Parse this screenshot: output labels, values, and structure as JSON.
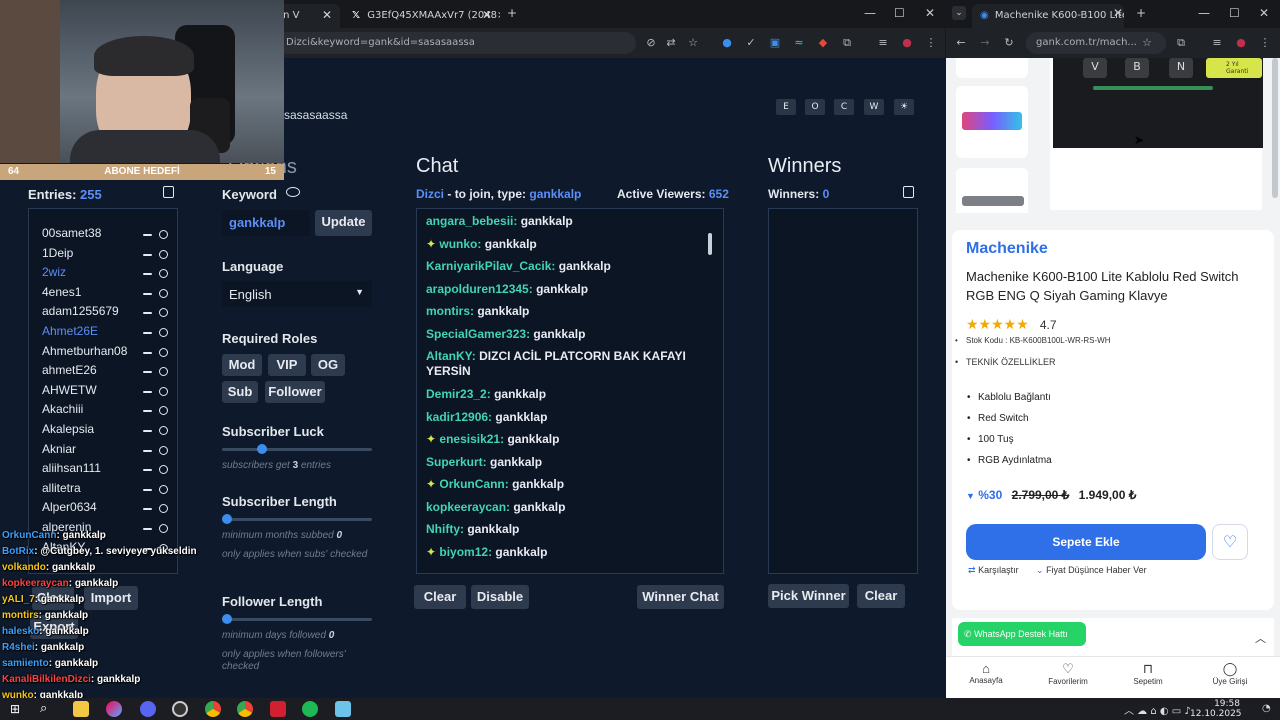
{
  "left_browser": {
    "tabs": [
      {
        "title": "ği (Uzun V"
      },
      {
        "title": "G3EfQ45XMAAxVr7 (2048×18"
      }
    ],
    "address": "Dizci&keyword=gank&id=sasasaassa",
    "window_controls": [
      "—",
      "☐",
      "✕"
    ]
  },
  "giveaway": {
    "channel_title": "sasasaassa",
    "corner_buttons": [
      "E",
      "O",
      "C",
      "W",
      "☀"
    ],
    "entries_heading": "Entries:",
    "entries_count": "255",
    "entries": [
      "00samet38",
      "1Deip",
      "2wiz",
      "4enes1",
      "adam1255679",
      "Ahmet26E",
      "Ahmetburhan08",
      "ahmetE26",
      "AHWETW",
      "Akachiii",
      "Akalepsia",
      "Akniar",
      "aliihsan111",
      "allitetra",
      "Alper0634",
      "alperenin",
      "AltanKY"
    ],
    "highlighted_entries": [
      2,
      5
    ],
    "clear_label": "Clear",
    "import_label": "Import",
    "export_label": "Export",
    "options_heading": "Options",
    "keyword_label": "Keyword",
    "keyword_value": "gankkalp",
    "update_label": "Update",
    "language_label": "Language",
    "language_value": "English",
    "roles_label": "Required Roles",
    "roles": [
      "Mod",
      "VIP",
      "OG",
      "Sub",
      "Follower"
    ],
    "sub_luck_label": "Subscriber Luck",
    "sub_luck_hint_pre": "subscribers get",
    "sub_luck_value": "3",
    "sub_luck_hint_post": "entries",
    "sub_luck_level": 0.25,
    "sub_length_label": "Subscriber Length",
    "sub_length_hint": "minimum months subbed",
    "sub_length_value": "0",
    "sub_length_note": "only applies when subs' checked",
    "follower_length_label": "Follower Length",
    "follower_length_hint": "minimum days followed",
    "follower_length_value": "0",
    "follower_length_note": "only applies when followers' checked",
    "chat_heading": "Chat",
    "chat_sub_channel": "Dizci",
    "chat_sub_mid": "- to join, type:",
    "chat_sub_keyword": "gankkalp",
    "active_viewers_label": "Active Viewers:",
    "active_viewers": "652",
    "chat_lines": [
      {
        "user": "angara_bebesii:",
        "msg": "gankkalp",
        "badge": false
      },
      {
        "user": "wunko:",
        "msg": "gankkalp",
        "badge": true
      },
      {
        "user": "KarniyarikPilav_Cacik:",
        "msg": "gankkalp",
        "badge": false
      },
      {
        "user": "arapolduren12345:",
        "msg": "gankkalp",
        "badge": false
      },
      {
        "user": "montirs:",
        "msg": "gankkalp",
        "badge": false
      },
      {
        "user": "SpecialGamer323:",
        "msg": "gankkalp",
        "badge": false
      },
      {
        "user": "AltanKY:",
        "msg": "DIZCI ACİL PLATCORN BAK KAFAYI YERSİN",
        "badge": false
      },
      {
        "user": "Demir23_2:",
        "msg": "gankkalp",
        "badge": false
      },
      {
        "user": "kadir12906:",
        "msg": "gankklap",
        "badge": false
      },
      {
        "user": "enesisik21:",
        "msg": "gankkalp",
        "badge": true
      },
      {
        "user": "Superkurt:",
        "msg": "gankkalp",
        "badge": false
      },
      {
        "user": "OrkunCann:",
        "msg": "gankkalp",
        "badge": true
      },
      {
        "user": "kopkeeraycan:",
        "msg": "gankkalp",
        "badge": false
      },
      {
        "user": "Nhifty:",
        "msg": "gankkalp",
        "badge": false
      },
      {
        "user": "biyom12:",
        "msg": "gankkalp",
        "badge": true
      }
    ],
    "chat_clear": "Clear",
    "chat_disable": "Disable",
    "winner_chat": "Winner Chat",
    "winners_heading": "Winners",
    "winners_label": "Winners:",
    "winners_count": "0",
    "pick_winner": "Pick Winner",
    "winners_clear": "Clear"
  },
  "stream_overlay": {
    "abone_left": "64",
    "abone_label": "ABONE HEDEFİ",
    "abone_right": "15",
    "chat": [
      {
        "user": "OrkunCann",
        "msg": ": gankkalp",
        "color": "#3aa0ff"
      },
      {
        "user": "BotRix",
        "msg": ": @Cutgbey, 1. seviyeye yükseldin",
        "color": "#3aa0ff"
      },
      {
        "user": "volkando",
        "msg": ": gankkalp",
        "color": "#f5c518"
      },
      {
        "user": "kopkeeraycan",
        "msg": ": gankkalp",
        "color": "#ff4040"
      },
      {
        "user": "yALI_7",
        "msg": ": gankkalp",
        "color": "#f5c518"
      },
      {
        "user": "montirs",
        "msg": ": gankkalp",
        "color": "#f5c518"
      },
      {
        "user": "halesko",
        "msg": ": gankkalp",
        "color": "#3aa0ff"
      },
      {
        "user": "R4shei",
        "msg": ": gankkalp",
        "color": "#3aa0ff"
      },
      {
        "user": "samiiento",
        "msg": ": gankkalp",
        "color": "#3aa0ff"
      },
      {
        "user": "KanaliBilkilenDizci",
        "msg": ": gankkalp",
        "color": "#ff4040"
      },
      {
        "user": "wunko",
        "msg": ": gankkalp",
        "color": "#f5c518"
      }
    ]
  },
  "right_browser": {
    "tab_title": "Machenike K600-B100 Lite Kabl",
    "address": "gank.com.tr/mach...",
    "badge_text": "2 Yıl Garanti",
    "keys": [
      "V",
      "B",
      "N"
    ],
    "brand": "Machenike",
    "product_title": "Machenike K600-B100 Lite Kablolu Red Switch RGB ENG Q Siyah Gaming Klavye",
    "rating": "4.7",
    "stock_code": "Stok Kodu : KB-K600B100L-WR-RS-WH",
    "spec_heading": "TEKNİK ÖZELLİKLER",
    "specs": [
      "Kablolu Bağlantı",
      "Red Switch",
      "100 Tuş",
      "RGB Aydınlatma"
    ],
    "discount": "%30",
    "old_price": "2.799,00 ₺",
    "new_price": "1.949,00 ₺",
    "add_to_cart": "Sepete Ekle",
    "compare": "Karşılaştır",
    "price_alert": "Fiyat Düşünce Haber Ver",
    "whatsapp": "WhatsApp Destek Hattı",
    "bottom_nav": [
      "Anasayfa",
      "Favorilerim",
      "Sepetim",
      "Üye Girişi"
    ],
    "colors": {
      "primary": "#2f6fe8",
      "brand": "#2f6fe8"
    }
  },
  "taskbar": {
    "time": "19:58",
    "date": "12.10.2025"
  }
}
